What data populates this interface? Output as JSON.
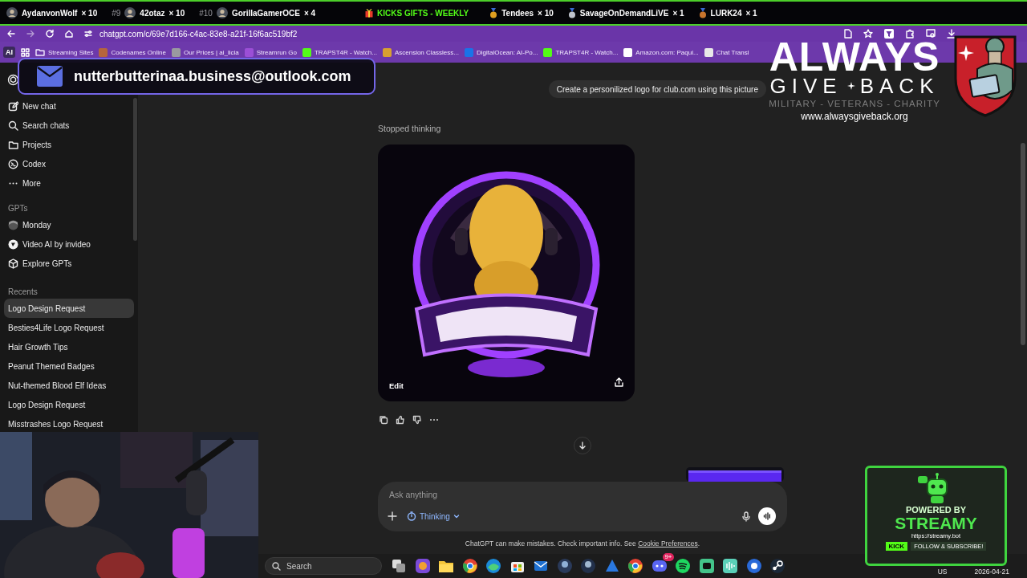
{
  "ticker": {
    "entries": [
      {
        "kind": "avatar",
        "name": "AydanvonWolf",
        "count": "× 10"
      },
      {
        "kind": "avatar",
        "rank": "#9",
        "name": "42otaz",
        "count": "× 10"
      },
      {
        "kind": "avatar",
        "rank": "#10",
        "name": "GorillaGamerOCE",
        "count": "× 4"
      }
    ],
    "title": "KICKS GIFTS - WEEKLY",
    "gifters": [
      {
        "name": "Tendees",
        "count": "× 10",
        "color": "#e0a020"
      },
      {
        "name": "SavageOnDemandLiVE",
        "count": "× 1",
        "color": "#c0c4cc"
      },
      {
        "name": "LURK24",
        "count": "× 1",
        "color": "#c8742c"
      }
    ]
  },
  "browser": {
    "url": "chatgpt.com/c/69e7d166-c4ac-83e8-a21f-16f6ac519bf2",
    "profile": "AI",
    "bookmarks": [
      {
        "kind": "folder",
        "label": "Streaming Sites"
      },
      {
        "kind": "site",
        "label": "Codenames Online",
        "color": "#b5653d"
      },
      {
        "kind": "site",
        "label": "Our Prices | ai_licia",
        "color": "#9a9aa0"
      },
      {
        "kind": "site",
        "label": "Streamrun Go",
        "color": "#9b4fd6"
      },
      {
        "kind": "site",
        "label": "TRAPST4R - Watch...",
        "color": "#53fc18"
      },
      {
        "kind": "site",
        "label": "Ascension Classless...",
        "color": "#d8a030"
      },
      {
        "kind": "site",
        "label": "DigitalOcean: AI-Po...",
        "color": "#1a73e8"
      },
      {
        "kind": "site",
        "label": "TRAPST4R - Watch...",
        "color": "#53fc18"
      },
      {
        "kind": "site",
        "label": "Amazon.com: Paqui...",
        "color": "#ffffff"
      },
      {
        "kind": "site",
        "label": "Chat Transl",
        "color": "#e8e8e8"
      }
    ]
  },
  "email_banner": {
    "text": "nutterbutterinaa.business@outlook.com"
  },
  "sidebar": {
    "nav": [
      {
        "label": "New chat"
      },
      {
        "label": "Search chats"
      },
      {
        "label": "Projects"
      },
      {
        "label": "Codex"
      },
      {
        "label": "More"
      }
    ],
    "gpts_heading": "GPTs",
    "gpts": [
      {
        "label": "Monday"
      },
      {
        "label": "Video AI by invideo"
      },
      {
        "label": "Explore GPTs"
      }
    ],
    "recents_heading": "Recents",
    "recents": [
      {
        "label": "Logo Design Request",
        "selected": true
      },
      {
        "label": "Besties4Life Logo Request",
        "selected": false
      },
      {
        "label": "Hair Growth Tips",
        "selected": false
      },
      {
        "label": "Peanut Themed Badges",
        "selected": false
      },
      {
        "label": "Nut-themed Blood Elf Ideas",
        "selected": false
      },
      {
        "label": "Logo Design Request",
        "selected": false
      },
      {
        "label": "Misstrashes Logo Request",
        "selected": false
      }
    ]
  },
  "chat": {
    "prompt": "Create a personilized logo for club.com using this picture",
    "status": "Stopped thinking",
    "image": {
      "kind": "picture",
      "edit": "Edit"
    },
    "composer": {
      "placeholder": "Ask anything",
      "mode": "Thinking"
    },
    "disclaimer": "ChatGPT can make mistakes. Check important info. See",
    "disclaimer_link": "Cookie Preferences",
    "disclaimer_end": "."
  },
  "taskbar": {
    "search": "Search",
    "badge": "9+",
    "language": "US",
    "date": "2026-04-21"
  },
  "giveback": {
    "word1": "ALWAYS",
    "word2": "GIVE",
    "word3": "BACK",
    "tagline": "MILITARY - VETERANS - CHARITY",
    "url": "www.alwaysgiveback.org"
  },
  "streamy": {
    "powered": "POWERED BY",
    "brand": "STREAMY",
    "url": "https://streamy.bot",
    "platform": "KICK",
    "cta": "FOLLOW & SUBSCRIBE!"
  }
}
